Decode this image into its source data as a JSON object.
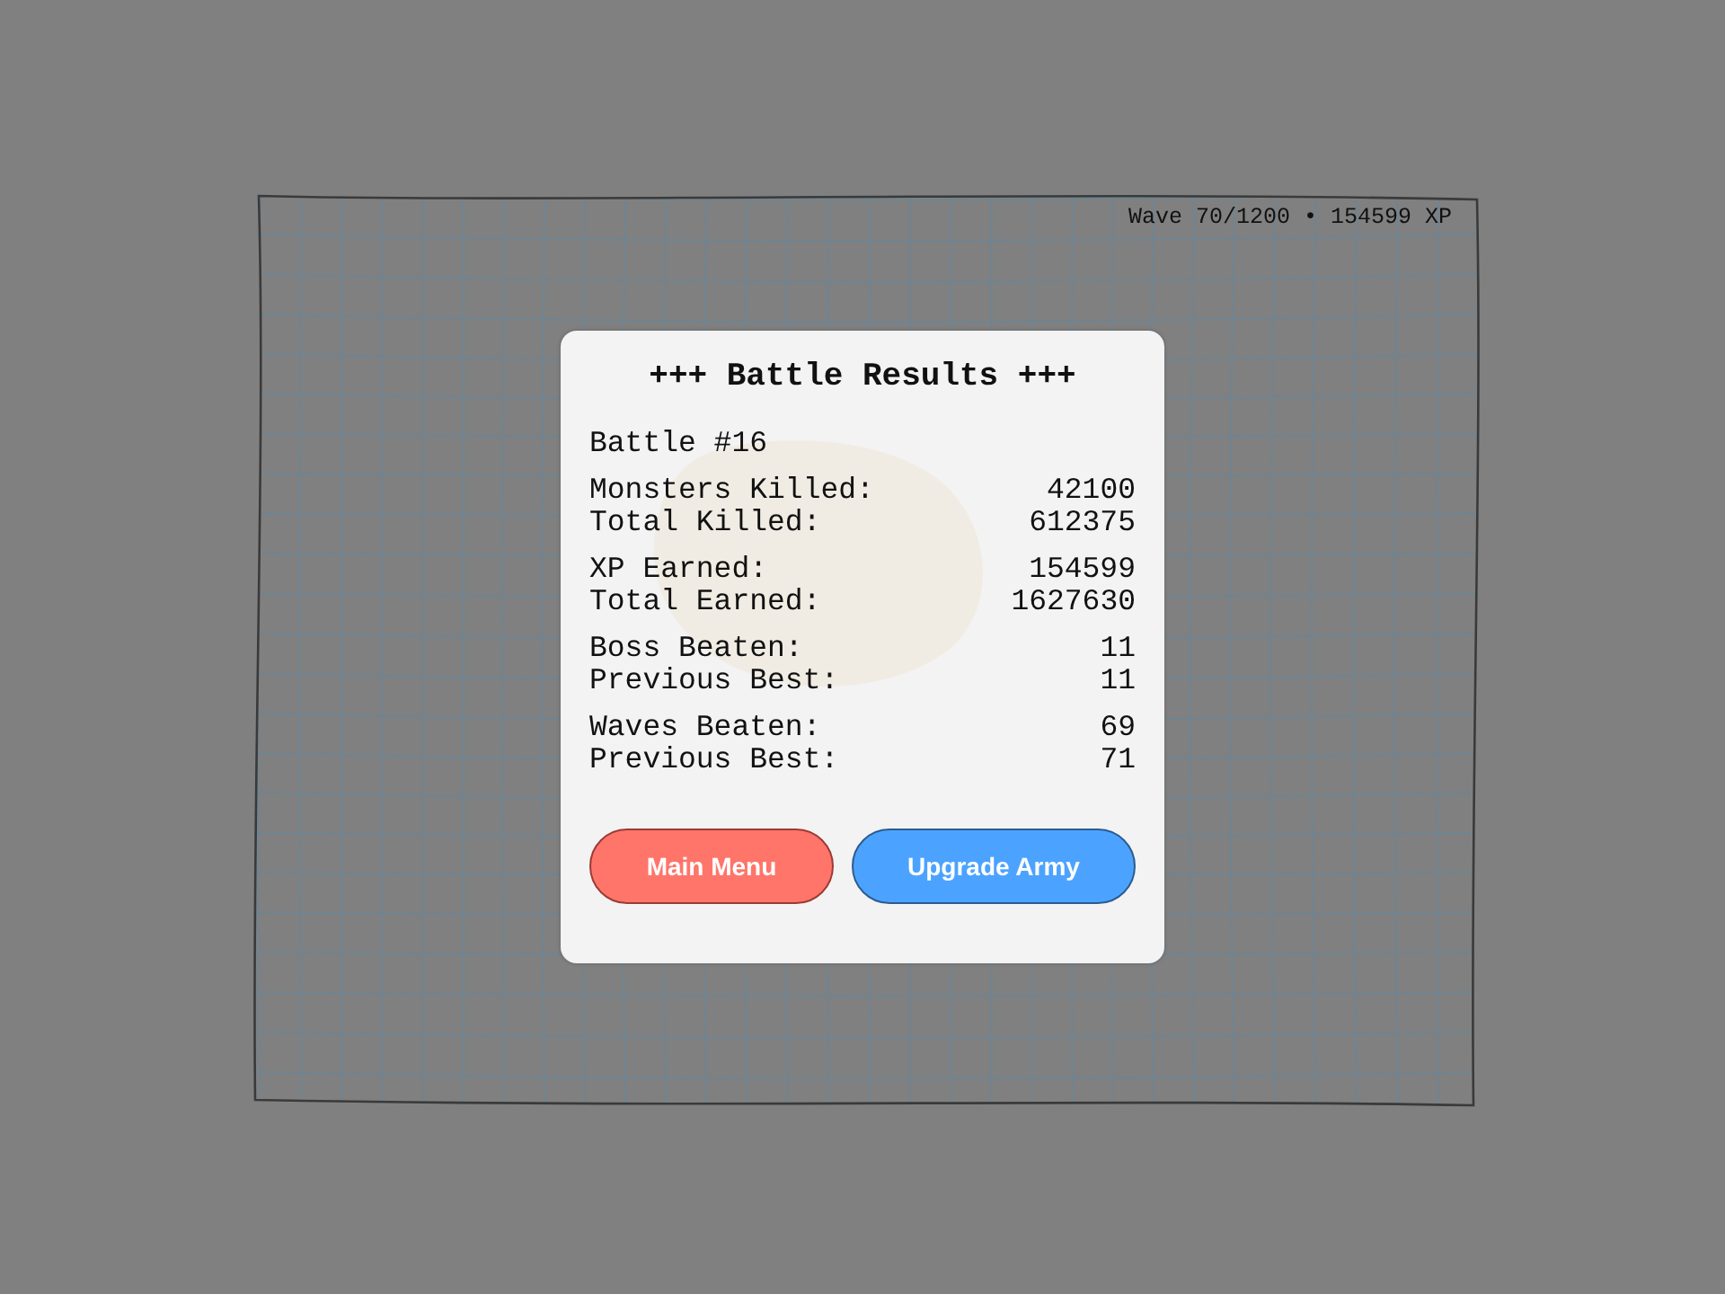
{
  "hud": {
    "text": "Wave 70/1200 • 154599 XP"
  },
  "dialog": {
    "title": "+++ Battle Results +++",
    "subtitle": "Battle #16",
    "groups": [
      {
        "rows": [
          {
            "label": "Monsters Killed:",
            "value": "42100"
          },
          {
            "label": "Total Killed:",
            "value": "612375"
          }
        ]
      },
      {
        "rows": [
          {
            "label": "XP Earned:",
            "value": "154599"
          },
          {
            "label": "Total Earned:",
            "value": "1627630"
          }
        ]
      },
      {
        "rows": [
          {
            "label": "Boss Beaten:",
            "value": "11"
          },
          {
            "label": "Previous Best:",
            "value": "11"
          }
        ]
      },
      {
        "rows": [
          {
            "label": "Waves Beaten:",
            "value": "69"
          },
          {
            "label": "Previous Best:",
            "value": "71"
          }
        ]
      }
    ],
    "buttons": [
      {
        "label": "Main Menu",
        "kind": "danger"
      },
      {
        "label": "Upgrade Army",
        "kind": "primary"
      }
    ]
  }
}
